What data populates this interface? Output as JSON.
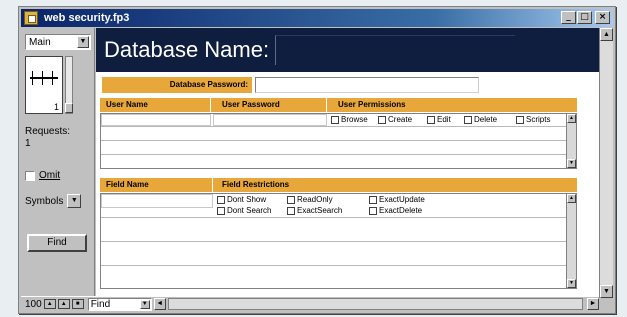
{
  "window": {
    "title": "web security.fp3"
  },
  "status_area": {
    "layout": "Main",
    "record_number": "1",
    "requests_label": "Requests:",
    "requests_count": "1",
    "omit_label": "Omit",
    "symbols_label": "Symbols",
    "find_button": "Find"
  },
  "header": {
    "db_name_label": "Database Name:"
  },
  "password": {
    "label": "Database Password:"
  },
  "users_table": {
    "col_user_name": "User Name",
    "col_user_password": "User Password",
    "col_user_permissions": "User Permissions",
    "permissions": [
      "Browse",
      "Create",
      "Edit",
      "Delete",
      "Scripts"
    ]
  },
  "fields_table": {
    "col_field_name": "Field Name",
    "col_field_restrictions": "Field Restrictions",
    "restrictions_row1": [
      "Dont Show",
      "ReadOnly",
      "ExactUpdate"
    ],
    "restrictions_row2": [
      "Dont Search",
      "ExactSearch",
      "ExactDelete"
    ]
  },
  "bottom_bar": {
    "zoom": "100",
    "mode": "Find"
  },
  "colors": {
    "accent": "#e8a73a",
    "header_bg": "#0f1d3e",
    "titlebar": "#0a246a"
  }
}
